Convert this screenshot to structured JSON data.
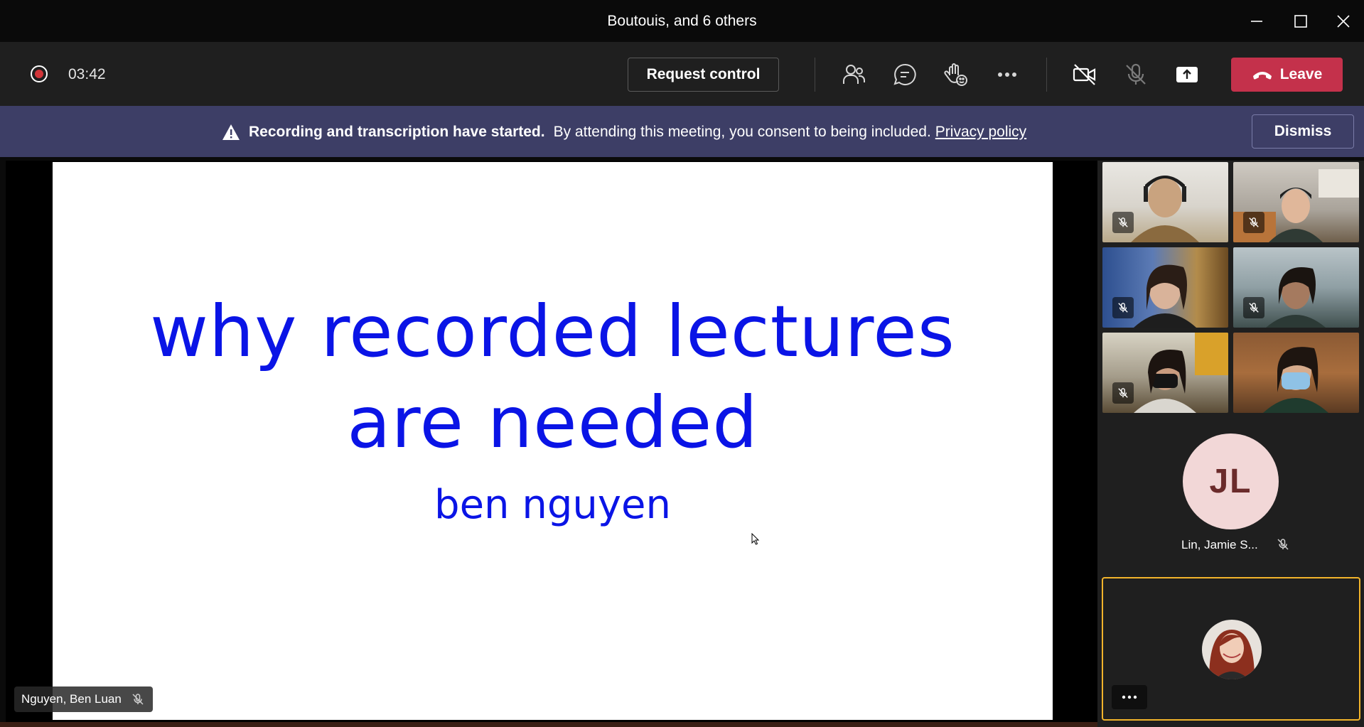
{
  "window": {
    "title": "Boutouis, and 6 others"
  },
  "toolbar": {
    "timer": "03:42",
    "request_control_label": "Request control",
    "leave_label": "Leave"
  },
  "banner": {
    "bold_text": "Recording and transcription have started.",
    "text": "By attending this meeting, you consent to being included.",
    "link": "Privacy policy",
    "dismiss_label": "Dismiss"
  },
  "slide": {
    "heading": "why recorded lectures are needed",
    "subtitle": "ben nguyen"
  },
  "presenter": {
    "name": "Nguyen, Ben Luan"
  },
  "participants": {
    "jl_initials": "JL",
    "jl_name": "Lin, Jamie S..."
  },
  "colors": {
    "accent_leave": "#c4314b",
    "banner": "#3d3e66",
    "slide_text": "#0a14e6",
    "self_border": "#f2b42b"
  }
}
